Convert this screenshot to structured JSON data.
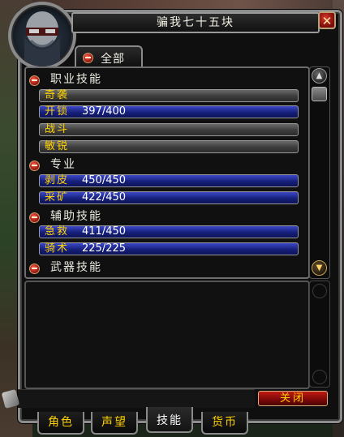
{
  "window": {
    "title": "骗我七十五块",
    "close_glyph": "✕",
    "close_button_label": "关闭"
  },
  "filter_tab": {
    "label": "全部"
  },
  "skill_list": {
    "categories": [
      {
        "name": "职业技能",
        "skills": [
          {
            "name": "奇袭",
            "rank": "",
            "fill": 0
          },
          {
            "name": "开锁",
            "rank": "397/400",
            "fill": 0.9925
          },
          {
            "name": "战斗",
            "rank": "",
            "fill": 0
          },
          {
            "name": "敏锐",
            "rank": "",
            "fill": 0
          }
        ]
      },
      {
        "name": "专业",
        "skills": [
          {
            "name": "剥皮",
            "rank": "450/450",
            "fill": 1
          },
          {
            "name": "采矿",
            "rank": "422/450",
            "fill": 0.9378
          }
        ]
      },
      {
        "name": "辅助技能",
        "skills": [
          {
            "name": "急救",
            "rank": "411/450",
            "fill": 0.9133
          },
          {
            "name": "骑术",
            "rank": "225/225",
            "fill": 1
          }
        ]
      },
      {
        "name": "武器技能",
        "skills": []
      }
    ]
  },
  "bottom_tabs": [
    {
      "label": "角色",
      "active": false
    },
    {
      "label": "声望",
      "active": false
    },
    {
      "label": "技能",
      "active": true
    },
    {
      "label": "货币",
      "active": false
    }
  ],
  "icons": {
    "portrait": "character-portrait-icon",
    "collapse": "minus-collapse-icon",
    "scroll_up": "scroll-up-icon",
    "scroll_down": "scroll-down-icon"
  },
  "colors": {
    "skill_name": "#ffd200",
    "skill_rank": "#ffffff",
    "bar_blue": "#16207a",
    "bar_gray": "#3c3c3c",
    "close_red": "#c01a12"
  }
}
